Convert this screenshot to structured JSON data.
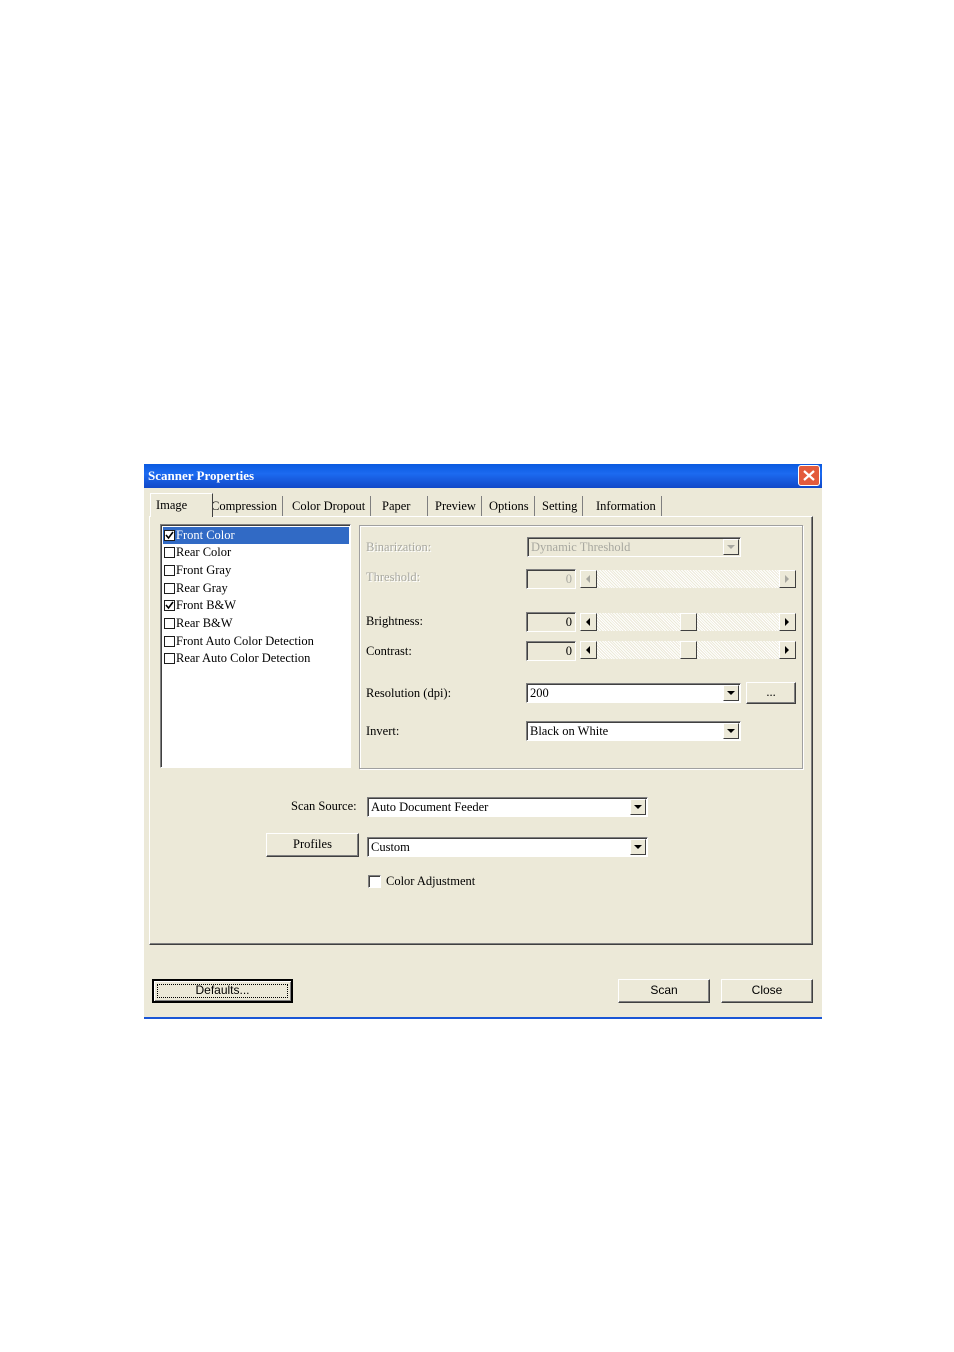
{
  "window": {
    "title": "Scanner Properties"
  },
  "tabs": [
    "Image",
    "Compression",
    "Color Dropout",
    "Paper",
    "Preview",
    "Options",
    "Setting",
    "Information"
  ],
  "image_types": [
    {
      "label": "Front Color",
      "checked": true,
      "selected": true
    },
    {
      "label": "Rear Color",
      "checked": false
    },
    {
      "label": "Front Gray",
      "checked": false
    },
    {
      "label": "Rear Gray",
      "checked": false
    },
    {
      "label": "Front B&W",
      "checked": true
    },
    {
      "label": "Rear B&W",
      "checked": false
    },
    {
      "label": "Front Auto Color Detection",
      "checked": false
    },
    {
      "label": "Rear Auto Color Detection",
      "checked": false
    }
  ],
  "settings": {
    "binarization_label": "Binarization:",
    "binarization_value": "Dynamic Threshold",
    "threshold_label": "Threshold:",
    "threshold_value": "0",
    "brightness_label": "Brightness:",
    "brightness_value": "0",
    "brightness_slider_fraction": 0.5,
    "contrast_label": "Contrast:",
    "contrast_value": "0",
    "contrast_slider_fraction": 0.5,
    "resolution_label": "Resolution (dpi):",
    "resolution_value": "200",
    "resolution_more_label": "...",
    "invert_label": "Invert:",
    "invert_value": "Black on White"
  },
  "scan_source": {
    "label": "Scan Source:",
    "value": "Auto Document Feeder"
  },
  "profiles": {
    "button_label": "Profiles",
    "value": "Custom"
  },
  "color_adjustment": {
    "label": "Color Adjustment",
    "checked": false
  },
  "buttons": {
    "defaults": "Defaults...",
    "scan": "Scan",
    "close": "Close"
  }
}
